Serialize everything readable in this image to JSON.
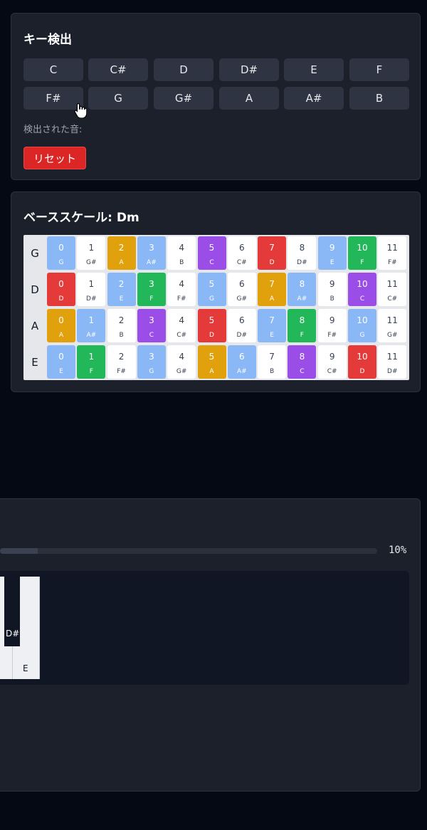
{
  "key_detect": {
    "title": "キー検出",
    "keys": [
      "C",
      "C#",
      "D",
      "D#",
      "E",
      "F",
      "F#",
      "G",
      "G#",
      "A",
      "A#",
      "B"
    ],
    "detected_label": "検出された音:",
    "reset_label": "リセット"
  },
  "bass_scale": {
    "title": "ベーススケール: Dm",
    "colors": {
      "blue": "#8ab8f7",
      "orange": "#e0a10c",
      "purple": "#9b4de8",
      "red": "#e53a3a",
      "green": "#22b85a",
      "white": "#ffffff"
    },
    "strings": [
      {
        "name": "G",
        "cells": [
          {
            "fret": "0",
            "note": "G",
            "color": "blue"
          },
          {
            "fret": "1",
            "note": "G#",
            "color": "white"
          },
          {
            "fret": "2",
            "note": "A",
            "color": "orange"
          },
          {
            "fret": "3",
            "note": "A#",
            "color": "blue"
          },
          {
            "fret": "4",
            "note": "B",
            "color": "white"
          },
          {
            "fret": "5",
            "note": "C",
            "color": "purple"
          },
          {
            "fret": "6",
            "note": "C#",
            "color": "white"
          },
          {
            "fret": "7",
            "note": "D",
            "color": "red"
          },
          {
            "fret": "8",
            "note": "D#",
            "color": "white"
          },
          {
            "fret": "9",
            "note": "E",
            "color": "blue"
          },
          {
            "fret": "10",
            "note": "F",
            "color": "green"
          },
          {
            "fret": "11",
            "note": "F#",
            "color": "white"
          }
        ]
      },
      {
        "name": "D",
        "cells": [
          {
            "fret": "0",
            "note": "D",
            "color": "red"
          },
          {
            "fret": "1",
            "note": "D#",
            "color": "white"
          },
          {
            "fret": "2",
            "note": "E",
            "color": "blue"
          },
          {
            "fret": "3",
            "note": "F",
            "color": "green"
          },
          {
            "fret": "4",
            "note": "F#",
            "color": "white"
          },
          {
            "fret": "5",
            "note": "G",
            "color": "blue"
          },
          {
            "fret": "6",
            "note": "G#",
            "color": "white"
          },
          {
            "fret": "7",
            "note": "A",
            "color": "orange"
          },
          {
            "fret": "8",
            "note": "A#",
            "color": "blue"
          },
          {
            "fret": "9",
            "note": "B",
            "color": "white"
          },
          {
            "fret": "10",
            "note": "C",
            "color": "purple"
          },
          {
            "fret": "11",
            "note": "C#",
            "color": "white"
          }
        ]
      },
      {
        "name": "A",
        "cells": [
          {
            "fret": "0",
            "note": "A",
            "color": "orange"
          },
          {
            "fret": "1",
            "note": "A#",
            "color": "blue"
          },
          {
            "fret": "2",
            "note": "B",
            "color": "white"
          },
          {
            "fret": "3",
            "note": "C",
            "color": "purple"
          },
          {
            "fret": "4",
            "note": "C#",
            "color": "white"
          },
          {
            "fret": "5",
            "note": "D",
            "color": "red"
          },
          {
            "fret": "6",
            "note": "D#",
            "color": "white"
          },
          {
            "fret": "7",
            "note": "E",
            "color": "blue"
          },
          {
            "fret": "8",
            "note": "F",
            "color": "green"
          },
          {
            "fret": "9",
            "note": "F#",
            "color": "white"
          },
          {
            "fret": "10",
            "note": "G",
            "color": "blue"
          },
          {
            "fret": "11",
            "note": "G#",
            "color": "white"
          }
        ]
      },
      {
        "name": "E",
        "cells": [
          {
            "fret": "0",
            "note": "E",
            "color": "blue"
          },
          {
            "fret": "1",
            "note": "F",
            "color": "green"
          },
          {
            "fret": "2",
            "note": "F#",
            "color": "white"
          },
          {
            "fret": "3",
            "note": "G",
            "color": "blue"
          },
          {
            "fret": "4",
            "note": "G#",
            "color": "white"
          },
          {
            "fret": "5",
            "note": "A",
            "color": "orange"
          },
          {
            "fret": "6",
            "note": "A#",
            "color": "blue"
          },
          {
            "fret": "7",
            "note": "B",
            "color": "white"
          },
          {
            "fret": "8",
            "note": "C",
            "color": "purple"
          },
          {
            "fret": "9",
            "note": "C#",
            "color": "white"
          },
          {
            "fret": "10",
            "note": "D",
            "color": "red"
          },
          {
            "fret": "11",
            "note": "D#",
            "color": "white"
          }
        ]
      }
    ]
  },
  "player": {
    "progress_value": 0.1,
    "progress_text": "10%",
    "piano_labels": {
      "black": "D#",
      "white": "E"
    }
  }
}
